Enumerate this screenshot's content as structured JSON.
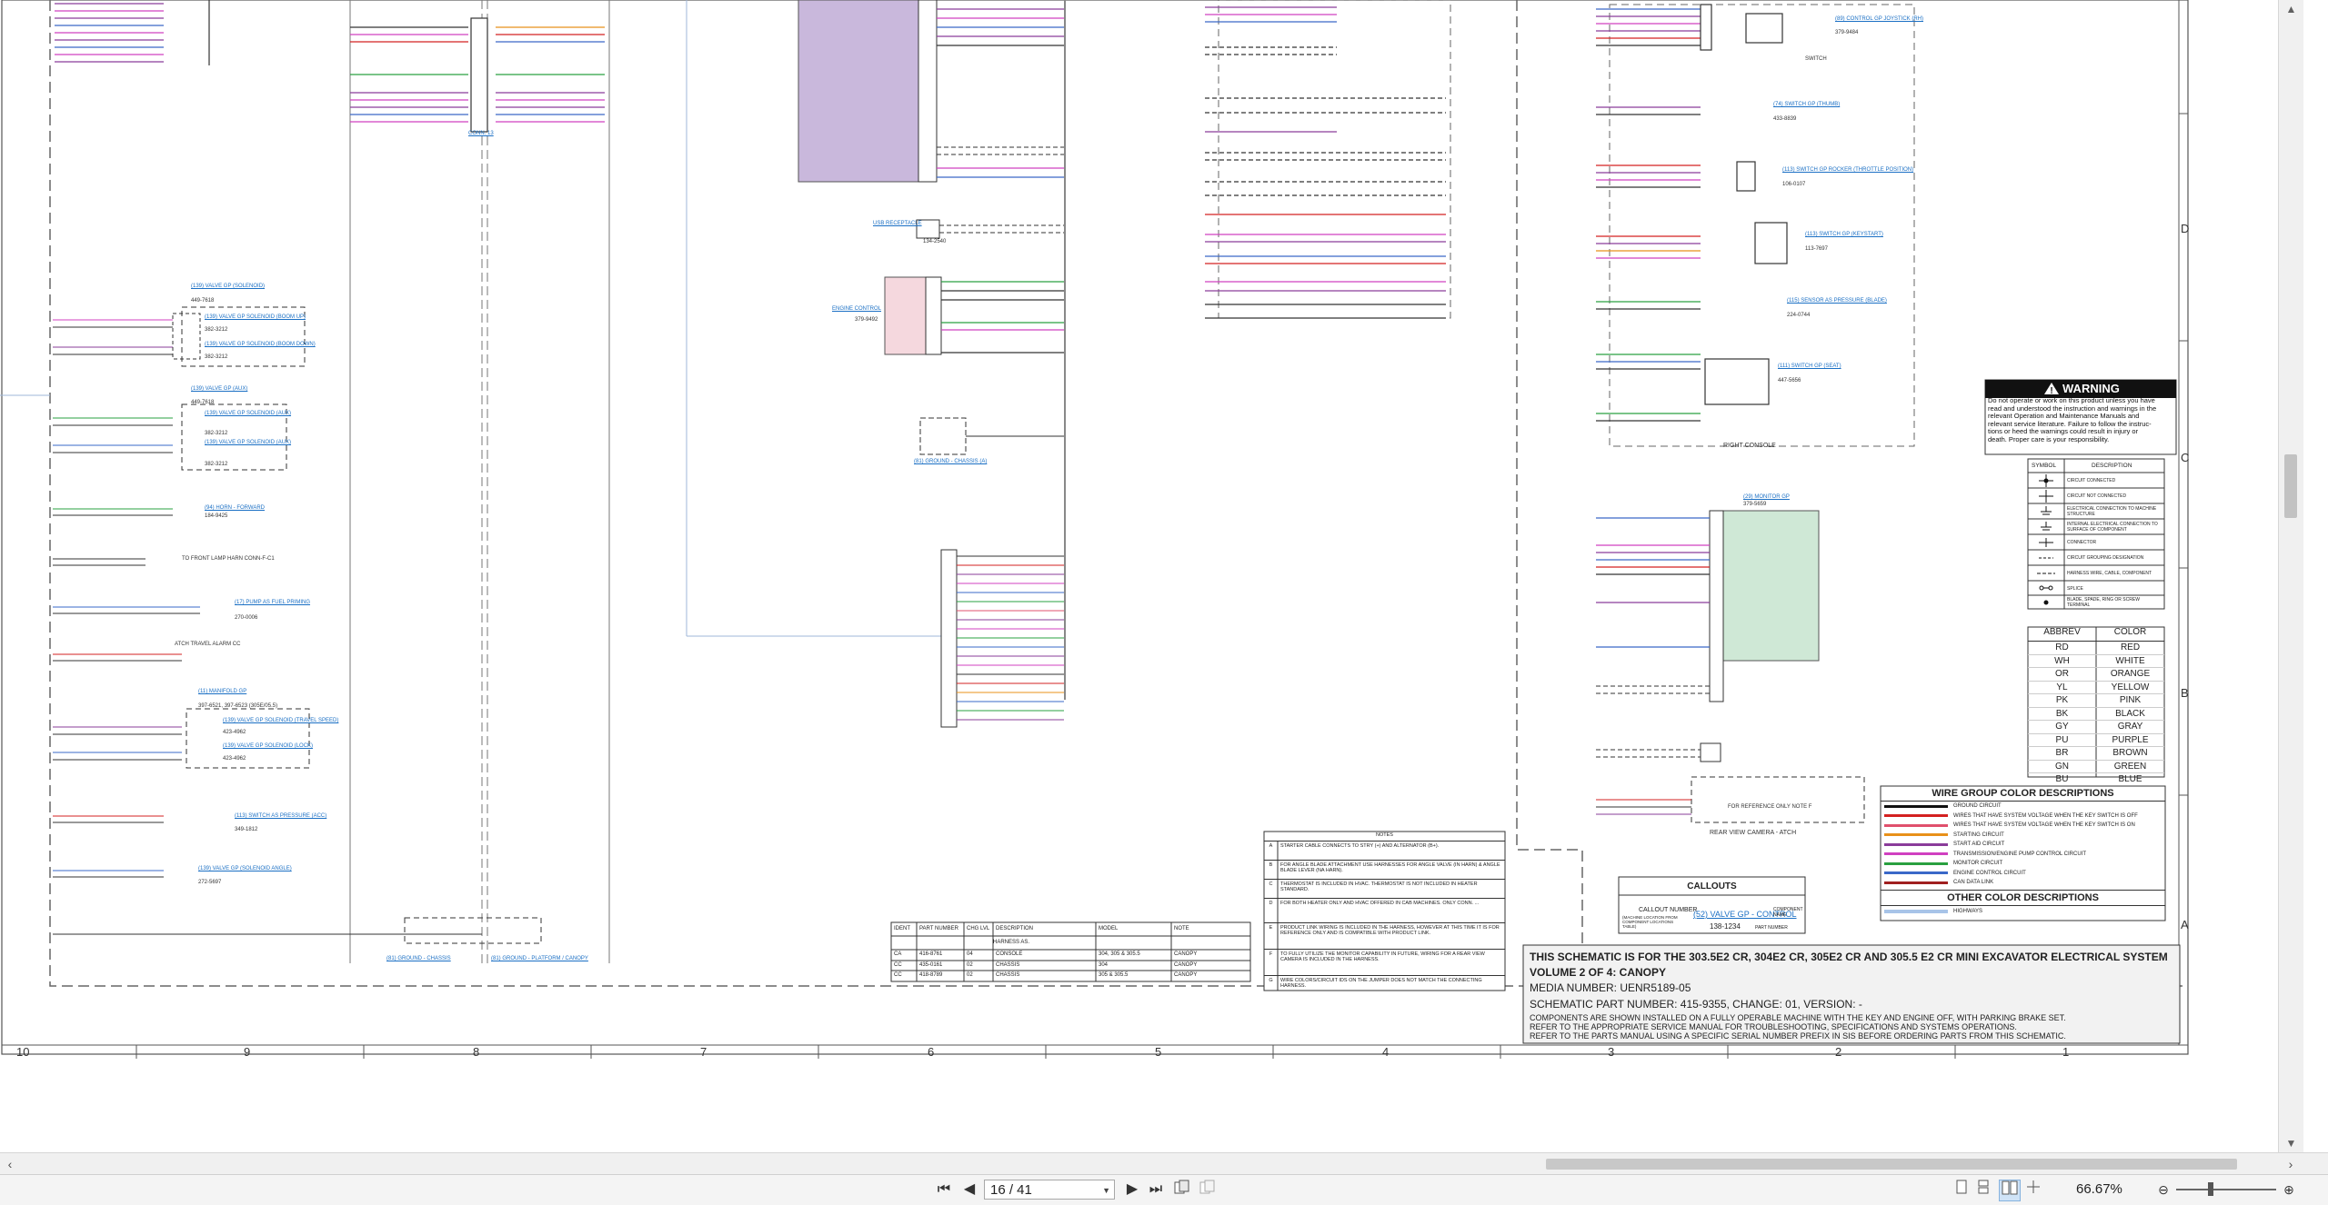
{
  "viewer": {
    "current_page": "16 / 41",
    "zoom": "66.67%",
    "toolbar_icons": [
      "first-page-icon",
      "prev-page-icon",
      "next-page-icon",
      "last-page-icon",
      "extract-page-icon",
      "copy-page-icon",
      "single-page-icon",
      "continuous-icon",
      "two-page-icon",
      "fit-icon",
      "zoom-out-icon",
      "zoom-in-icon"
    ]
  },
  "sheet": {
    "title_block": {
      "line1": "THIS SCHEMATIC IS FOR THE 303.5E2 CR, 304E2 CR, 305E2 CR AND 305.5 E2 CR MINI EXCAVATOR ELECTRICAL SYSTEM",
      "line2": "VOLUME 2 OF 4: CANOPY",
      "line3": "MEDIA NUMBER: UENR5189-05",
      "line4": "SCHEMATIC PART NUMBER: 415-9355, CHANGE: 01, VERSION: -",
      "line5": "COMPONENTS ARE SHOWN INSTALLED ON A FULLY OPERABLE MACHINE WITH THE KEY AND ENGINE OFF, WITH PARKING BRAKE SET.",
      "line6": "REFER TO THE APPROPRIATE SERVICE MANUAL FOR TROUBLESHOOTING, SPECIFICATIONS AND SYSTEMS OPERATIONS.",
      "line7": "REFER TO THE PARTS MANUAL USING A SPECIFIC SERIAL NUMBER PREFIX IN SIS BEFORE ORDERING PARTS FROM THIS SCHEMATIC."
    },
    "zones_bottom": [
      "10",
      "9",
      "8",
      "7",
      "6",
      "5",
      "4",
      "3",
      "2",
      "1"
    ],
    "zones_right": [
      "D",
      "C",
      "B",
      "A"
    ],
    "warning": {
      "title": "WARNING",
      "text": [
        "Do not operate or work on this product unless you have",
        "read and understood the instruction and warnings in the",
        "relevant Operation and Maintenance Manuals and",
        "relevant service literature. Failure to follow the instruc-",
        "tions or heed the warnings could result in injury or",
        "death. Proper care is your responsibility."
      ]
    },
    "symbols": {
      "headers": [
        "SYMBOL",
        "DESCRIPTION"
      ],
      "rows": [
        "CIRCUIT CONNECTED",
        "CIRCUIT NOT CONNECTED",
        "ELECTRICAL CONNECTION TO MACHINE STRUCTURE",
        "INTERNAL ELECTRICAL CONNECTION TO SURFACE OF COMPONENT",
        "CONNECTOR",
        "CIRCUIT GROUPING DESIGNATION",
        "HARNESS WIRE, CABLE, COMPONENT",
        "SPLICE",
        "BLADE, SPADE, RING OR SCREW TERMINAL"
      ]
    },
    "abbrev": {
      "headers": [
        "ABBREV",
        "COLOR"
      ],
      "rows": [
        [
          "RD",
          "RED"
        ],
        [
          "WH",
          "WHITE"
        ],
        [
          "OR",
          "ORANGE"
        ],
        [
          "YL",
          "YELLOW"
        ],
        [
          "PK",
          "PINK"
        ],
        [
          "BK",
          "BLACK"
        ],
        [
          "GY",
          "GRAY"
        ],
        [
          "PU",
          "PURPLE"
        ],
        [
          "BR",
          "BROWN"
        ],
        [
          "GN",
          "GREEN"
        ],
        [
          "BU",
          "BLUE"
        ]
      ]
    },
    "wire_groups": {
      "title": "WIRE GROUP COLOR DESCRIPTIONS",
      "rows": [
        {
          "color": "#111111",
          "label": "GROUND CIRCUIT"
        },
        {
          "color": "#d32020",
          "label": "WIRES THAT HAVE SYSTEM VOLTAGE WHEN THE KEY SWITCH IS OFF"
        },
        {
          "color": "#e0506c",
          "label": "WIRES THAT HAVE SYSTEM VOLTAGE WHEN THE KEY SWITCH IS ON"
        },
        {
          "color": "#e8901a",
          "label": "STARTING CIRCUIT"
        },
        {
          "color": "#8a3c9a",
          "label": "START AID CIRCUIT"
        },
        {
          "color": "#d040c0",
          "label": "TRANSMISSION/ENGINE PUMP CONTROL CIRCUIT"
        },
        {
          "color": "#2aa040",
          "label": "MONITOR CIRCUIT"
        },
        {
          "color": "#3a68c8",
          "label": "ENGINE CONTROL CIRCUIT"
        },
        {
          "color": "#a02020",
          "label": "CAN DATA LINK"
        }
      ],
      "other_title": "OTHER COLOR DESCRIPTIONS",
      "other_rows": [
        {
          "color": "#a8c4e8",
          "label": "HIGHWAYS"
        }
      ]
    },
    "callouts": {
      "title": "CALLOUTS",
      "callout_number": "CALLOUT NUMBER",
      "location_note": "(MACHINE LOCATION FROM COMPONENT LOCATIONS TABLE)",
      "example": "(52) VALVE GP - CONTROL",
      "part": "138-1234",
      "part_label": "PART NUMBER",
      "component_name": "COMPONENT NAME"
    },
    "notes": {
      "title": "NOTES",
      "rows": [
        [
          "A",
          "STARTER CABLE CONNECTS TO STRY (+) AND ALTERNATOR (B+)."
        ],
        [
          "B",
          "FOR ANGLE BLADE ATTACHMENT USE HARNESSES FOR ANGLE VALVE (IN HARN) & ANGLE BLADE LEVER (NA HARN)."
        ],
        [
          "C",
          "THERMOSTAT IS INCLUDED IN HVAC. THERMOSTAT IS NOT INCLUDED IN HEATER STANDARD."
        ],
        [
          "D",
          "FOR BOTH HEATER ONLY AND HVAC OFFERED IN CAB MACHINES. ONLY CONN. ..."
        ],
        [
          "E",
          "PRODUCT LINK WIRING IS INCLUDED IN THE HARNESS, HOWEVER AT THIS TIME IT IS FOR REFERENCE ONLY AND IS COMPATIBLE WITH PRODUCT LINK."
        ],
        [
          "F",
          "TO FULLY UTILIZE THE MONITOR CAPABILITY IN FUTURE, WIRING FOR A REAR VIEW CAMERA IS INCLUDED IN THE HARNESS."
        ],
        [
          "G",
          "WIRE COLORS/CIRCUIT IDS ON THE JUMPER DOES NOT MATCH THE CONNECTING HARNESS."
        ]
      ]
    },
    "harness_table": {
      "headers": [
        "IDENT",
        "PART NUMBER",
        "CHG LVL",
        "DESCRIPTION",
        "MODEL",
        "NOTE"
      ],
      "caption": "HARNESS AS.",
      "rows": [
        [
          "CA",
          "416-8761",
          "04",
          "CONSOLE",
          "304, 305 & 305.5",
          "CANOPY"
        ],
        [
          "CC",
          "435-0161",
          "02",
          "CHASSIS",
          "304",
          "CANOPY"
        ],
        [
          "CC",
          "418-8789",
          "02",
          "CHASSIS",
          "305 & 305.5",
          "CANOPY"
        ]
      ]
    },
    "labels": {
      "right_console": "RIGHT CONSOLE",
      "rear_camera": "REAR VIEW CAMERA - ATCH",
      "for_reference": "FOR REFERENCE ONLY NOTE F",
      "ground_chassis": "(81) GROUND - CHASSIS (A)",
      "ground_platform": "(81) GROUND - PLATFORM / CANOPY",
      "ground_chassis_b": "(81) GROUND - CHASSIS",
      "monitor_callout": "(29) MONITOR GP",
      "monitor_part": "379-5659",
      "usb_receptacle": "USB RECEPTACLE",
      "usb_part": "134-2540",
      "ecm": "ENGINE CONTROL",
      "ecm_part": "379-9492",
      "conn_label": "CONN. 13",
      "switch_label": "SWITCH",
      "warn_lamp": "TO FRONT LAMP HARN CONN-F-C1",
      "atch_alarm": "ATCH TRAVEL ALARM CC",
      "solenoids": [
        {
          "callout": "(139) VALVE GP (SOLENOID)",
          "part": "449-7618"
        },
        {
          "callout": "(139) VALVE GP SOLENOID (BOOM UP)",
          "part": "382-3212"
        },
        {
          "callout": "(139) VALVE GP SOLENOID (BOOM DOWN)",
          "part": "382-3212"
        },
        {
          "callout": "(139) VALVE GP (AUX)",
          "part": "449-7618"
        },
        {
          "callout": "(139) VALVE GP SOLENOID (AUX)",
          "part": "382-3212"
        },
        {
          "callout": "(139) VALVE GP SOLENOID (AUX)",
          "part": "382-3212"
        },
        {
          "callout": "(94) HORN - FORWARD",
          "part": "184-9425"
        },
        {
          "callout": "(17) PUMP AS FUEL PRIMING",
          "part": "270-0006"
        },
        {
          "callout": "(11) MANIFOLD GP",
          "part": "397-6521, 397-6523 (305E/05.5)"
        },
        {
          "callout": "(139) VALVE GP SOLENOID (TRAVEL SPEED)",
          "part": "423-4962"
        },
        {
          "callout": "(139) VALVE GP SOLENOID (LOCK)",
          "part": "423-4962"
        },
        {
          "callout": "(113) SWITCH AS PRESSURE (ACC)",
          "part": "349-1812"
        },
        {
          "callout": "(139) VALVE GP (SOLENOID ANGLE)",
          "part": "272-5697"
        }
      ],
      "right_components": [
        {
          "callout": "(89) CONTROL GP JOYSTICK (RH)",
          "part": "379-9484"
        },
        {
          "callout": "(74) SWITCH GP (THUMB)",
          "part": "433-8839"
        },
        {
          "callout": "(113) SWITCH GP ROCKER (THROTTLE POSITION)",
          "part": "106-0107"
        },
        {
          "callout": "(113) SWITCH GP (KEYSTART)",
          "part": "113-7697"
        },
        {
          "callout": "(115) SENSOR AS PRESSURE (BLADE)",
          "part": "224-0744"
        },
        {
          "callout": "(111) SWITCH GP (SEAT)",
          "part": "447-5656"
        }
      ]
    }
  }
}
